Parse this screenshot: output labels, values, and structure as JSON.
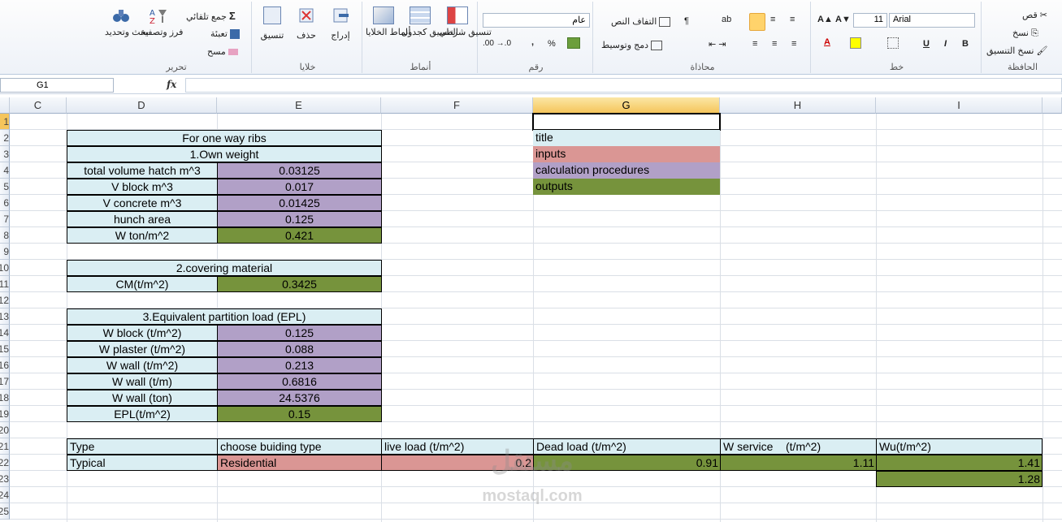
{
  "ribbon": {
    "clipboard": {
      "label": "الحافظة",
      "cut": "قص",
      "copy": "نسخ",
      "format_painter": "نسخ التنسيق"
    },
    "font": {
      "label": "خط",
      "name": "Arial",
      "size": "11"
    },
    "alignment": {
      "label": "محاذاة",
      "wrap": "التفاف النص",
      "merge": "دمج وتوسيط"
    },
    "number": {
      "label": "رقم",
      "format": "عام"
    },
    "styles": {
      "label": "أنماط",
      "conditional": "تنسيق شرطي",
      "as_table": "التنسيق كجدول",
      "cell_styles": "أنماط الخلايا"
    },
    "cells": {
      "label": "خلايا",
      "insert": "إدراج",
      "delete": "حذف",
      "format": "تنسيق"
    },
    "editing": {
      "label": "تحرير",
      "autosum": "جمع تلقائي",
      "fill": "تعبئة",
      "clear": "مسح",
      "sort": "فرز وتصفية",
      "find": "بحث وتحديد"
    }
  },
  "formula_bar": {
    "name_box": "G1",
    "fx": "fx",
    "content": ""
  },
  "columns": [
    "C",
    "D",
    "E",
    "F",
    "G",
    "H",
    "I"
  ],
  "rows": [
    "1",
    "2",
    "3",
    "4",
    "5",
    "6",
    "7",
    "8",
    "9",
    "10",
    "11",
    "12",
    "13",
    "14",
    "15",
    "16",
    "17",
    "18",
    "19",
    "20",
    "21",
    "22",
    "23",
    "24",
    "25"
  ],
  "own_weight": {
    "heading": "For one way ribs",
    "title": "1.Own weight",
    "rows": [
      {
        "label": "total volume hatch m^3",
        "value": "0.03125"
      },
      {
        "label": "V block m^3",
        "value": "0.017"
      },
      {
        "label": "V concrete m^3",
        "value": "0.01425"
      },
      {
        "label": "hunch area",
        "value": "0.125"
      },
      {
        "label": "W ton/m^2",
        "value": "0.421"
      }
    ]
  },
  "covering": {
    "title": "2.covering material",
    "label": "CM(t/m^2)",
    "value": "0.3425"
  },
  "epl": {
    "title": "3.Equivalent partition load (EPL)",
    "rows": [
      {
        "label": "W block (t/m^2)",
        "value": "0.125"
      },
      {
        "label": "W plaster (t/m^2)",
        "value": "0.088"
      },
      {
        "label": "W wall (t/m^2)",
        "value": "0.213"
      },
      {
        "label": "W wall (t/m)",
        "value": "0.6816"
      },
      {
        "label": "W wall (ton)",
        "value": "24.5376"
      },
      {
        "label": "EPL(t/m^2)",
        "value": "0.15"
      }
    ]
  },
  "legend": [
    "title",
    "inputs",
    "calculation procedures",
    "outputs"
  ],
  "summary": {
    "headers": [
      "Type",
      "choose buiding type",
      "live load (t/m^2)",
      "Dead load (t/m^2)",
      "W service    (t/m^2)",
      "Wu(t/m^2)"
    ],
    "values": [
      "Typical",
      "Residential",
      "0.2",
      "0.91",
      "1.11",
      "1.41"
    ],
    "extra": "1.28"
  },
  "watermark": {
    "arabic": "مستقل",
    "latin": "mostaql.com"
  },
  "colors": {
    "title": "#daeef3",
    "input": "#da9694",
    "calc": "#b1a0c7",
    "output": "#76933c"
  }
}
